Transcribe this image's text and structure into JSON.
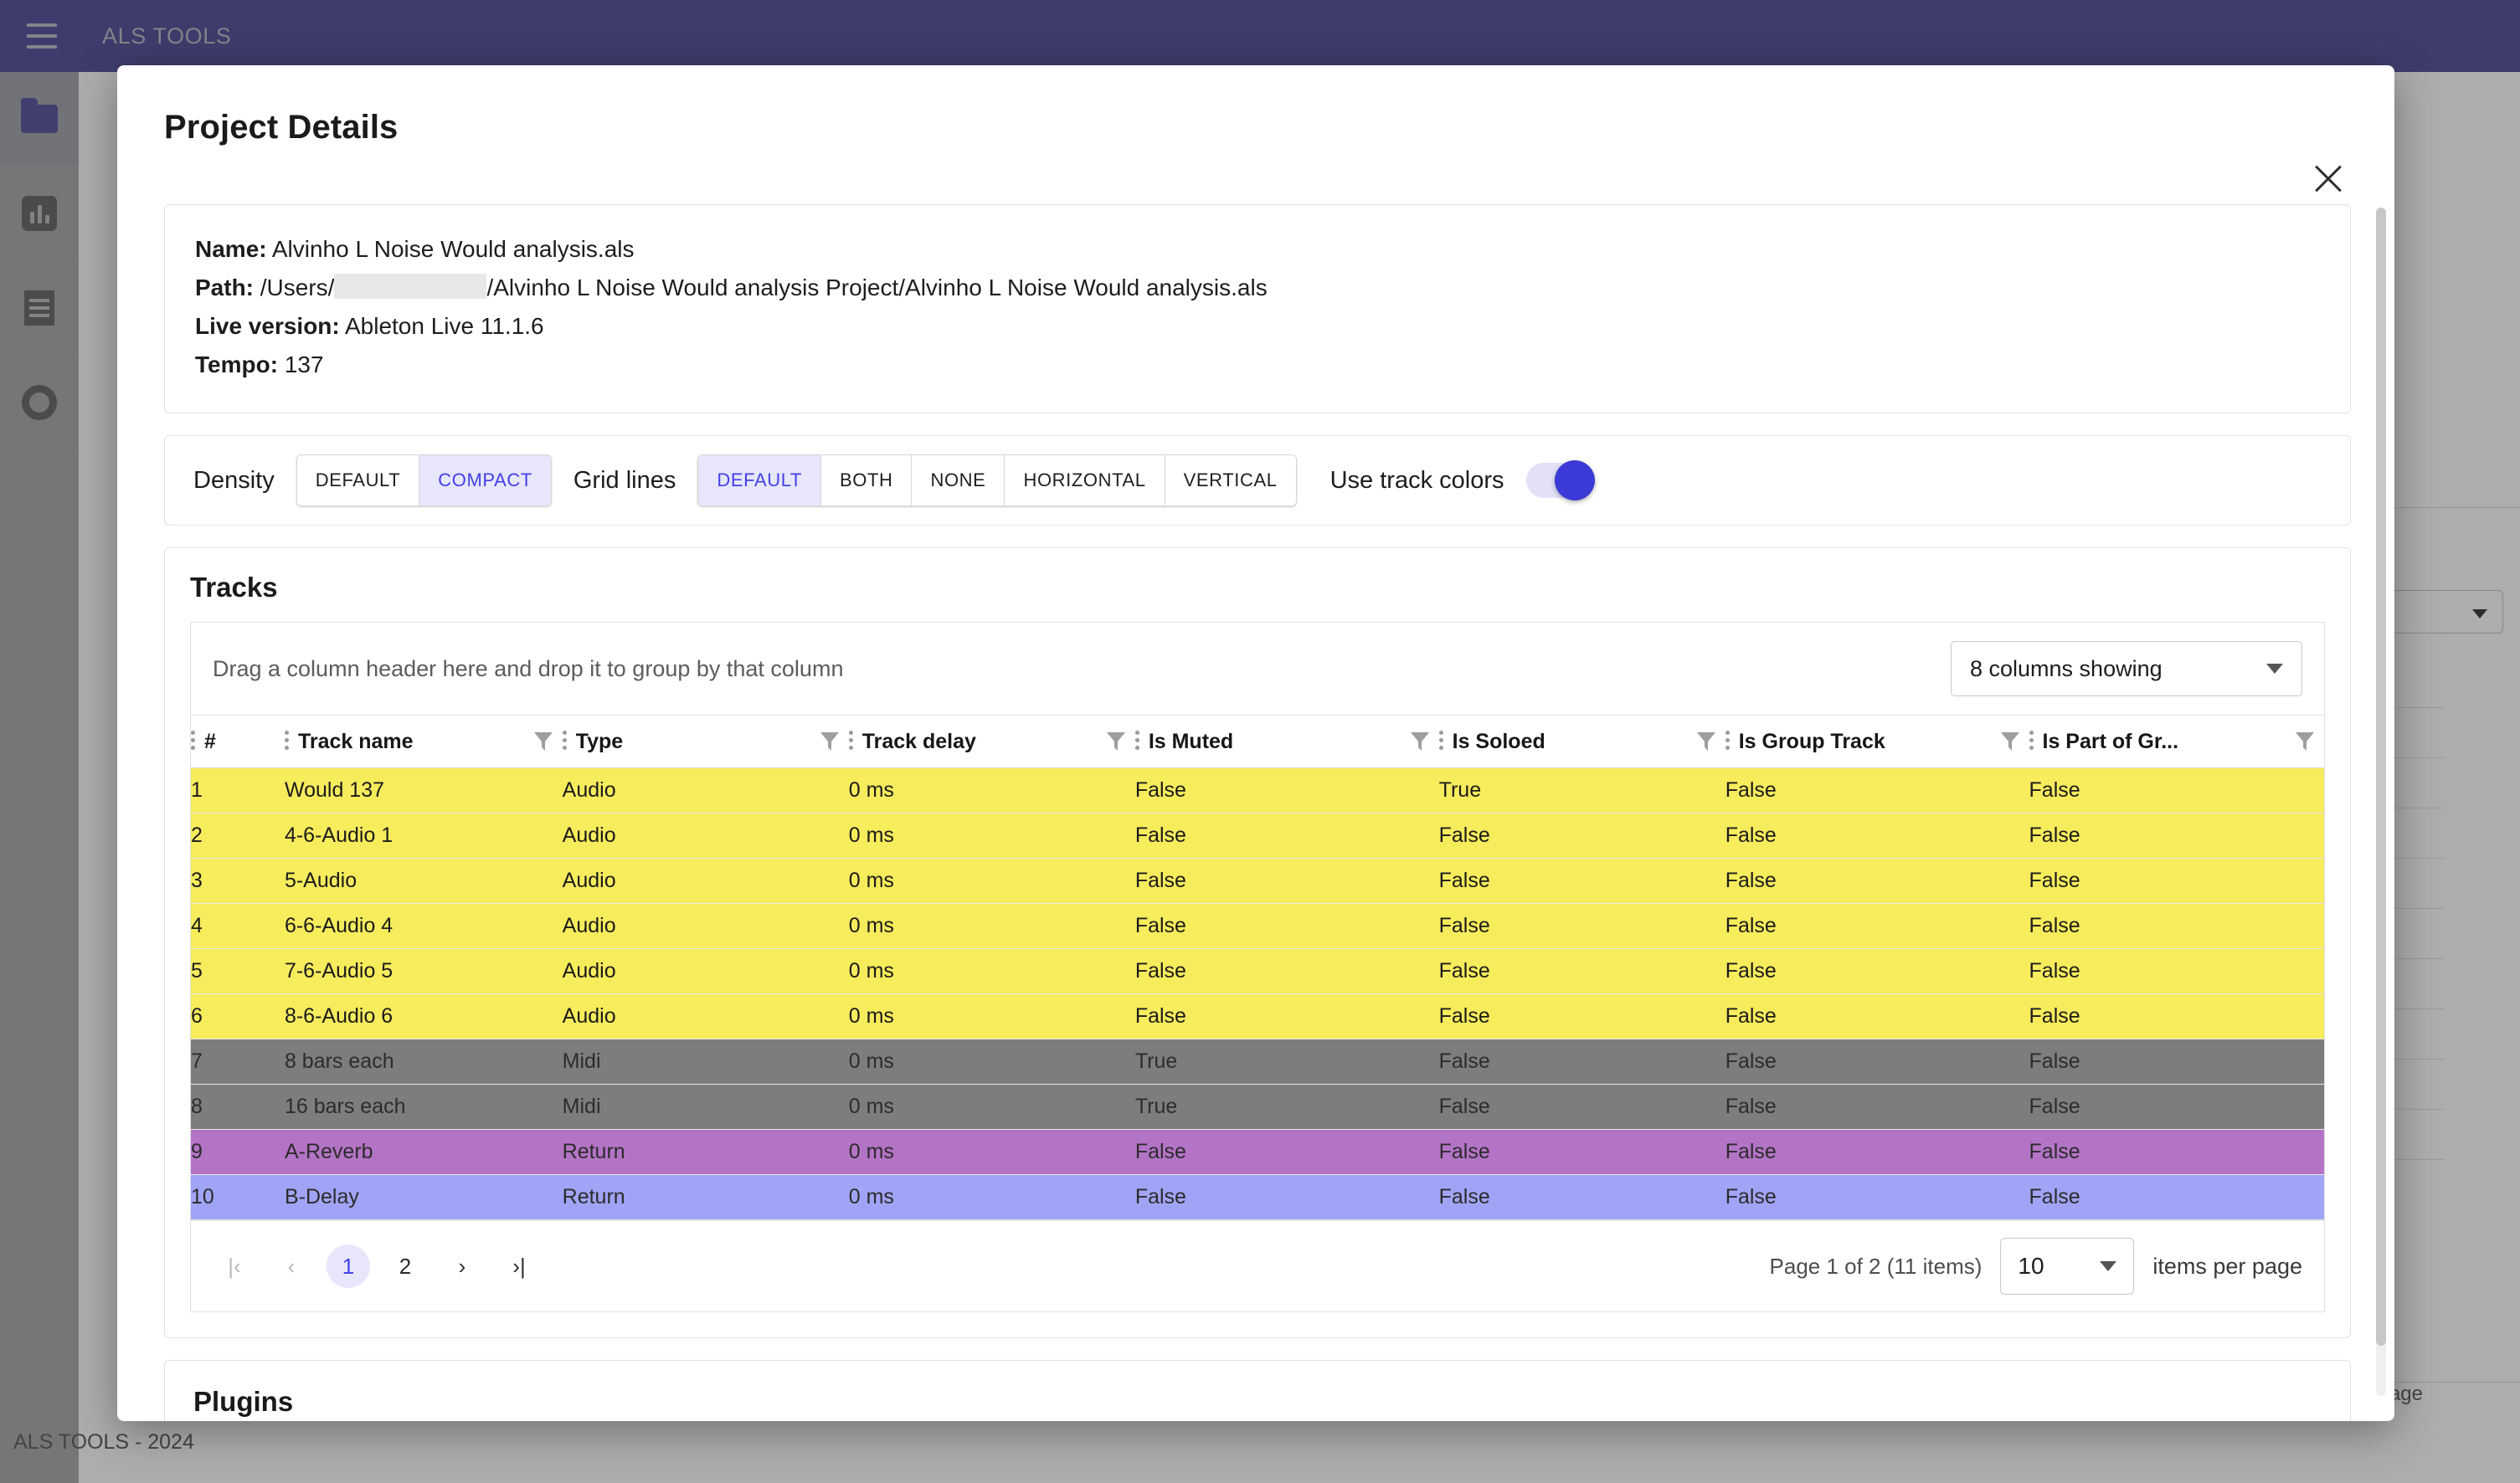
{
  "app": {
    "title": "ALS TOOLS",
    "footer": "ALS TOOLS - 2024",
    "menu_icon": "hamburger-icon"
  },
  "sidebar": {
    "items": [
      {
        "icon": "folder-icon",
        "active": true
      },
      {
        "icon": "chart-bar-icon",
        "active": false
      },
      {
        "icon": "document-icon",
        "active": false
      },
      {
        "icon": "gear-icon",
        "active": false
      }
    ]
  },
  "background": {
    "items_per_page_label": "items per page"
  },
  "modal": {
    "title": "Project Details",
    "close_icon": "close-icon",
    "info": {
      "name_label": "Name:",
      "name_value": "Alvinho L Noise Would analysis.als",
      "path_label": "Path:",
      "path_prefix": "/Users/",
      "path_redacted": "",
      "path_suffix": "/Alvinho L Noise Would analysis Project/Alvinho L Noise Would analysis.als",
      "live_version_label": "Live version:",
      "live_version_value": "Ableton Live 11.1.6",
      "tempo_label": "Tempo:",
      "tempo_value": "137"
    },
    "options": {
      "density_label": "Density",
      "density_options": [
        "DEFAULT",
        "COMPACT"
      ],
      "density_selected": "COMPACT",
      "gridlines_label": "Grid lines",
      "gridlines_options": [
        "DEFAULT",
        "BOTH",
        "NONE",
        "HORIZONTAL",
        "VERTICAL"
      ],
      "gridlines_selected": "DEFAULT",
      "track_colors_label": "Use track colors",
      "track_colors_on": true
    },
    "tracks": {
      "title": "Tracks",
      "group_hint": "Drag a column header here and drop it to group by that column",
      "columns_showing": "8 columns showing",
      "columns": [
        "#",
        "Track name",
        "Type",
        "Track delay",
        "Is Muted",
        "Is Soloed",
        "Is Group Track",
        "Is Part of Gr..."
      ],
      "rows": [
        {
          "num": "1",
          "name": "Would 137",
          "type": "Audio",
          "delay": "0 ms",
          "muted": "False",
          "soloed": "True",
          "group": "False",
          "part": "False",
          "color": "yellow"
        },
        {
          "num": "2",
          "name": "4-6-Audio 1",
          "type": "Audio",
          "delay": "0 ms",
          "muted": "False",
          "soloed": "False",
          "group": "False",
          "part": "False",
          "color": "yellow"
        },
        {
          "num": "3",
          "name": "5-Audio",
          "type": "Audio",
          "delay": "0 ms",
          "muted": "False",
          "soloed": "False",
          "group": "False",
          "part": "False",
          "color": "yellow"
        },
        {
          "num": "4",
          "name": "6-6-Audio 4",
          "type": "Audio",
          "delay": "0 ms",
          "muted": "False",
          "soloed": "False",
          "group": "False",
          "part": "False",
          "color": "yellow"
        },
        {
          "num": "5",
          "name": "7-6-Audio 5",
          "type": "Audio",
          "delay": "0 ms",
          "muted": "False",
          "soloed": "False",
          "group": "False",
          "part": "False",
          "color": "yellow"
        },
        {
          "num": "6",
          "name": "8-6-Audio 6",
          "type": "Audio",
          "delay": "0 ms",
          "muted": "False",
          "soloed": "False",
          "group": "False",
          "part": "False",
          "color": "yellow"
        },
        {
          "num": "7",
          "name": "8 bars each",
          "type": "Midi",
          "delay": "0 ms",
          "muted": "True",
          "soloed": "False",
          "group": "False",
          "part": "False",
          "color": "gray"
        },
        {
          "num": "8",
          "name": "16 bars each",
          "type": "Midi",
          "delay": "0 ms",
          "muted": "True",
          "soloed": "False",
          "group": "False",
          "part": "False",
          "color": "gray"
        },
        {
          "num": "9",
          "name": "A-Reverb",
          "type": "Return",
          "delay": "0 ms",
          "muted": "False",
          "soloed": "False",
          "group": "False",
          "part": "False",
          "color": "purple"
        },
        {
          "num": "10",
          "name": "B-Delay",
          "type": "Return",
          "delay": "0 ms",
          "muted": "False",
          "soloed": "False",
          "group": "False",
          "part": "False",
          "color": "blue"
        }
      ],
      "pagination": {
        "first_label": "|‹",
        "prev_label": "‹",
        "pages": [
          "1",
          "2"
        ],
        "active_page": "1",
        "next_label": "›",
        "last_label": "›|",
        "status": "Page 1 of 2 (11 items)",
        "items_per_page_value": "10",
        "items_per_page_label": "items per page"
      }
    },
    "plugins": {
      "title": "Plugins"
    }
  },
  "colors": {
    "brand": "#3f3d8f",
    "accent": "#4341e8",
    "accent_bg": "#e7e6fb",
    "row_yellow": "#f6ec5c",
    "row_gray": "#7d7d7d",
    "row_purple": "#b474c6",
    "row_blue": "#a0a4f6"
  }
}
